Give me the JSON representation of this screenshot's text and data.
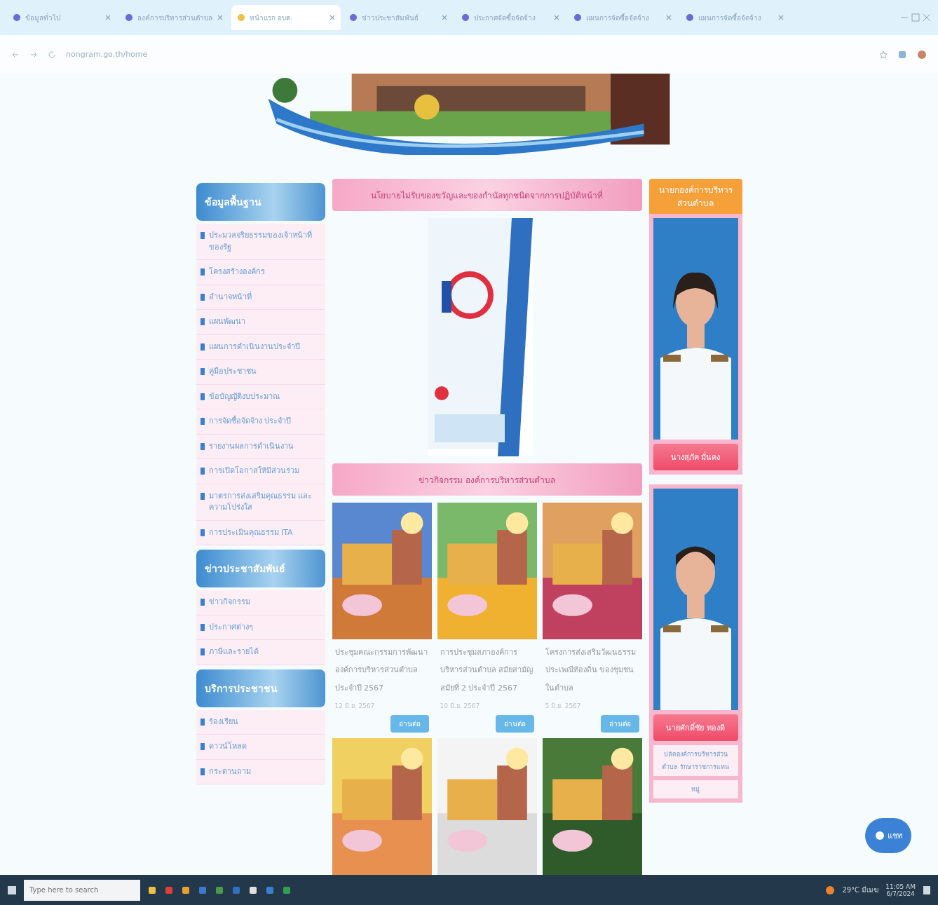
{
  "browser": {
    "tabs": [
      {
        "title": "ข้อมูลทั่วไป",
        "selected": false
      },
      {
        "title": "องค์การบริหารส่วนตำบล",
        "selected": false
      },
      {
        "title": "หน้าแรก อบต.",
        "selected": true
      },
      {
        "title": "ข่าวประชาสัมพันธ์",
        "selected": false
      },
      {
        "title": "ประกาศจัดซื้อจัดจ้าง",
        "selected": false
      },
      {
        "title": "แผนการจัดซื้อจัดจ้าง",
        "selected": false
      },
      {
        "title": "แผนการจัดซื้อจัดจ้าง",
        "selected": false
      }
    ],
    "address": "nongram.go.th/home"
  },
  "sidebar": [
    {
      "heading": "ข้อมูลพื้นฐาน",
      "items": [
        "ประมวลจริยธรรมของเจ้าหน้าที่ของรัฐ",
        "โครงสร้างองค์กร",
        "อำนาจหน้าที่",
        "แผนพัฒนา",
        "แผนการดำเนินงานประจำปี",
        "คู่มือประชาชน",
        "ข้อบัญญัติงบประมาณ",
        "การจัดซื้อจัดจ้าง ประจำปี",
        "รายงานผลการดำเนินงาน",
        "การเปิดโอกาสให้มีส่วนร่วม",
        "มาตรการส่งเสริมคุณธรรม และความโปร่งใส",
        "การประเมินคุณธรรม ITA"
      ]
    },
    {
      "heading": "ข่าวประชาสัมพันธ์",
      "items": [
        "ข่าวกิจกรรม",
        "ประกาศต่างๆ",
        "ภาษีและรายได้"
      ]
    },
    {
      "heading": "บริการประชาชน",
      "items": [
        "ร้องเรียน",
        "ดาวน์โหลด",
        "กระดานถาม"
      ]
    }
  ],
  "announcement": "นโยบายไม่รับของขวัญและของกำนัลทุกชนิดจากการปฏิบัติหน้าที่",
  "news": {
    "heading": "ข่าวกิจกรรม องค์การบริหารส่วนตำบล",
    "items": [
      {
        "title": "ประชุมคณะกรรมการพัฒนา องค์การบริหารส่วนตำบล ประจำปี 2567",
        "date": "12 มิ.ย. 2567",
        "button": "อ่านต่อ"
      },
      {
        "title": "การประชุมสภาองค์การ บริหารส่วนตำบล สมัยสามัญ สมัยที่ 2 ประจำปี 2567",
        "date": "10 มิ.ย. 2567",
        "button": "อ่านต่อ"
      },
      {
        "title": "โครงการส่งเสริมวัฒนธรรม ประเพณีท้องถิ่น ของชุมชนในตำบล",
        "date": "5 มิ.ย. 2567",
        "button": "อ่านต่อ"
      }
    ]
  },
  "officials": {
    "heading": "นายกองค์การบริหารส่วนตำบล",
    "people": [
      {
        "name": "นางสุภัค มั่นคง"
      },
      {
        "name": "นายศักดิ์ชัย ทองดี"
      }
    ],
    "caption": "ปลัดองค์การบริหารส่วนตำบล รักษาราชการแทน",
    "note": "หมู่"
  },
  "chat_button": "แชท",
  "taskbar": {
    "search_placeholder": "Type here to search",
    "weather": "29°C มีเมฆ",
    "time": "11:05 AM",
    "date": "6/7/2024"
  }
}
